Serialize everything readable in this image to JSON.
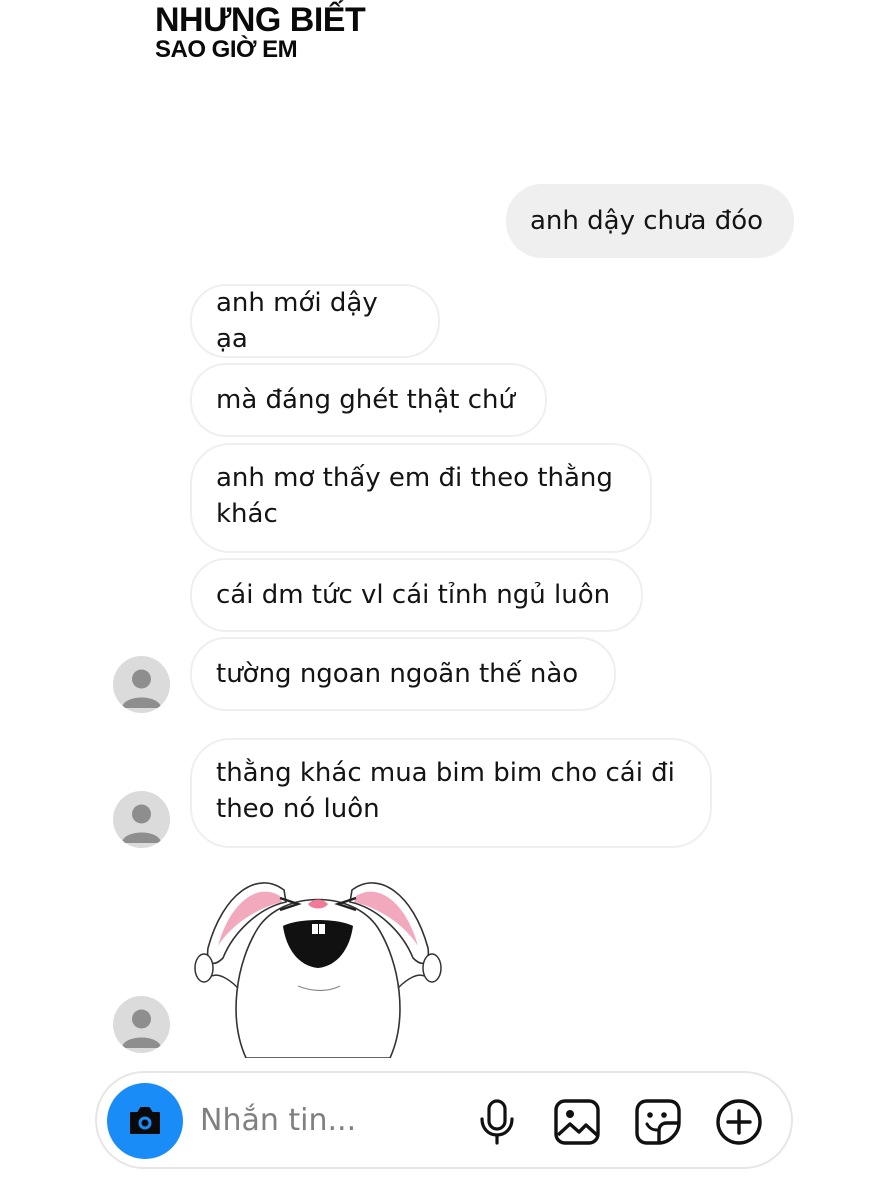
{
  "caption": {
    "line1": "NHƯNG BIẾT",
    "line2": "SAO GIỜ EM"
  },
  "messages": [
    {
      "from": "me",
      "text": "anh dậy chưa đóo"
    },
    {
      "from": "them",
      "text": "anh mới dậy ạa"
    },
    {
      "from": "them",
      "text": "mà đáng ghét thật chứ"
    },
    {
      "from": "them",
      "text": "anh mơ thấy em đi theo thằng khác"
    },
    {
      "from": "them",
      "text": "cái dm tức vl cái tỉnh ngủ luôn"
    },
    {
      "from": "them",
      "text": "tường ngoan ngoãn thế nào"
    },
    {
      "from": "them",
      "text": "thằng khác mua bim bim cho cái đi theo nó luôn"
    }
  ],
  "sticker": {
    "name": "screaming-rabbit-sticker"
  },
  "composer": {
    "placeholder": "Nhắn tin...",
    "icons": [
      "camera-icon",
      "microphone-icon",
      "image-icon",
      "sticker-icon",
      "plus-circle-icon"
    ],
    "accent_color": "#1a8cf7"
  },
  "colors": {
    "outgoing_bubble": "#efefef",
    "incoming_border": "#efefef",
    "avatar": "#dbdbdb"
  }
}
